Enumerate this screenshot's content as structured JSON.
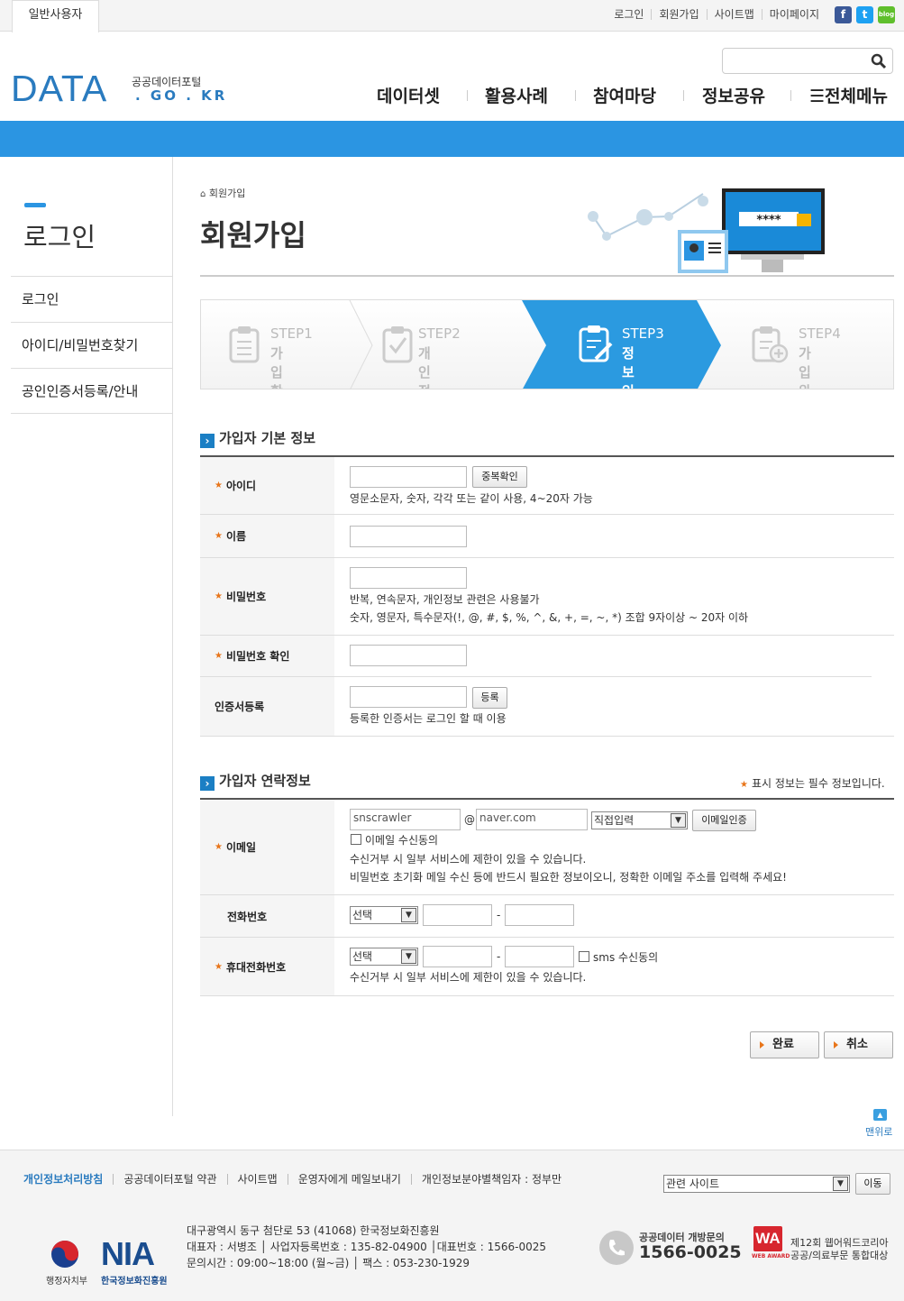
{
  "topbar": {
    "user_tab": "일반사용자",
    "links": [
      "로그인",
      "회원가입",
      "사이트맵",
      "마이페이지"
    ],
    "sns": [
      {
        "icon": "facebook-icon",
        "glyph": "f",
        "color": "#3b5998"
      },
      {
        "icon": "twitter-icon",
        "glyph": "t",
        "color": "#1da1f2"
      },
      {
        "icon": "blog-icon",
        "glyph": "blog",
        "color": "#5fbf2c"
      }
    ]
  },
  "header": {
    "logo_main": "DATA",
    "logo_sub1": "공공데이터포털",
    "logo_sub2": ". GO . KR",
    "search_placeholder": "",
    "nav": [
      "데이터셋",
      "활용사례",
      "참여마당",
      "정보공유",
      "☰전체메뉴"
    ]
  },
  "lnb": {
    "title": "로그인",
    "items": [
      "로그인",
      "아이디/비밀번호찾기",
      "공인인증서등록/안내"
    ]
  },
  "content": {
    "breadcrumb": "회원가입",
    "page_title": "회원가입",
    "illustration_password": "****",
    "steps": [
      {
        "num": "STEP1",
        "label": "가입확인"
      },
      {
        "num": "STEP2",
        "label": "개인정보 수집 동의"
      },
      {
        "num": "STEP3",
        "label": "정보입력"
      },
      {
        "num": "STEP4",
        "label": "가입완료"
      }
    ],
    "active_step_color": "#2b9ae0"
  },
  "basic": {
    "heading": "가입자 기본 정보",
    "id_label": "아이디",
    "dup_button": "중복확인",
    "id_help": "영문소문자, 숫자, 각각 또는 같이 사용, 4~20자 가능",
    "name_label": "이름",
    "pw_label": "비밀번호",
    "pw_help1": "반복, 연속문자, 개인정보 관련은 사용불가",
    "pw_help2": "숫자, 영문자, 특수문자(!, @, #, $, %, ^, &, +, =, ~, *) 조합 9자이상 ~ 20자 이하",
    "pw_confirm_label": "비밀번호 확인",
    "cert_label": "인증서등록",
    "cert_button": "등록",
    "cert_help": "등록한 인증서는 로그인 할 때 이용"
  },
  "contact": {
    "heading": "가입자 연락정보",
    "required_note": "표시 정보는 필수 정보입니다.",
    "email_label": "이메일",
    "email_id": "snscrawler",
    "email_at": "@",
    "email_domain": "naver.com",
    "email_select": "직접입력",
    "email_button": "이메일인증",
    "email_consent": "이메일 수신동의",
    "email_help1": "수신거부 시 일부 서비스에 제한이 있을 수 있습니다.",
    "email_help2": "비밀번호 초기화 메일 수신 등에 반드시 필요한 정보이오니, 정확한 이메일 주소를 입력해 주세요!",
    "phone_label": "전화번호",
    "phone_select": "선택",
    "dash": "-",
    "mobile_label": "휴대전화번호",
    "mobile_select": "선택",
    "sms_consent": "sms 수신동의",
    "mobile_help": "수신거부 시 일부 서비스에 제한이 있을 수 있습니다."
  },
  "actions": {
    "complete": "완료",
    "cancel": "취소",
    "top": "맨위로"
  },
  "footer": {
    "links": [
      "개인정보처리방침",
      "공공데이터포털 약관",
      "사이트맵",
      "운영자에게 메일보내기",
      "개인정보분야별책임자 : 정부만"
    ],
    "related_select": "관련 사이트",
    "go_button": "이동",
    "address": "대구광역시 동구 첨단로 53 (41068) 한국정보화진흥원",
    "info_line": "대표자 : 서병조 │ 사업자등록번호 : 135-82-04900 │대표번호 : 1566-0025",
    "hours": "문의시간 : 09:00~18:00 (월~금) │ 팩스 : 053-230-1929",
    "gov_label": "행정자치부",
    "nia_logo": "NIA",
    "nia_label": "한국정보화진흥원",
    "contact_title": "공공데이터 개방문의",
    "contact_number": "1566-0025",
    "award_logo": "WA",
    "award_sub": "WEB AWARD",
    "award_line1": "제12회 웹어워드코리아",
    "award_line2": "공공/의료부문 통합대상"
  }
}
